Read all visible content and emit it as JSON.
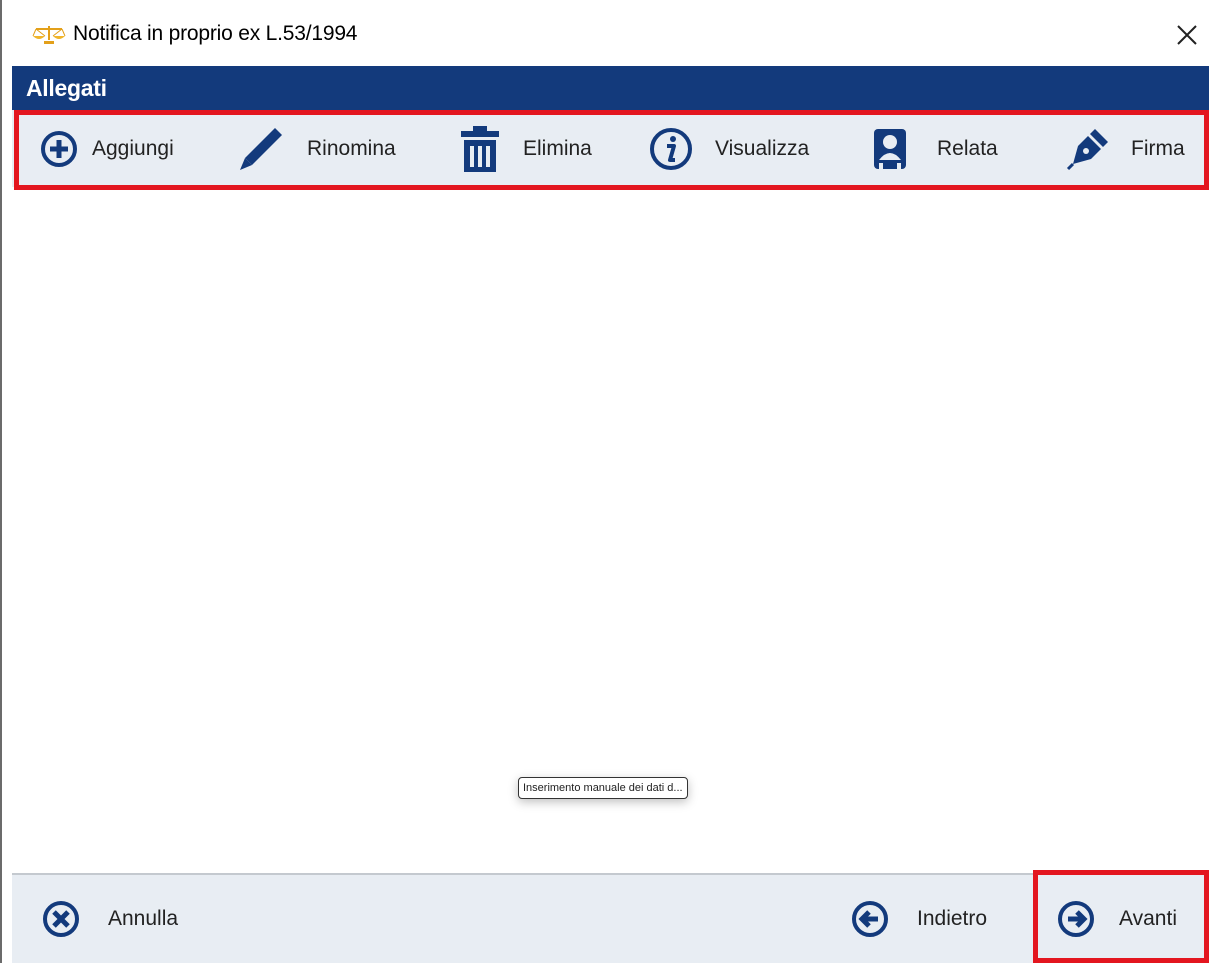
{
  "window": {
    "title": "Notifica in proprio ex L.53/1994",
    "close_icon": "close-icon"
  },
  "section": {
    "title": "Allegati"
  },
  "toolbar": {
    "items": [
      {
        "label": "Aggiungi",
        "icon": "add-circle-icon"
      },
      {
        "label": "Rinomina",
        "icon": "pencil-icon"
      },
      {
        "label": "Elimina",
        "icon": "trash-icon"
      },
      {
        "label": "Visualizza",
        "icon": "info-circle-icon"
      },
      {
        "label": "Relata",
        "icon": "person-badge-icon"
      },
      {
        "label": "Firma",
        "icon": "pen-nib-icon"
      }
    ]
  },
  "tooltip": {
    "text": "Inserimento manuale dei dati d..."
  },
  "footer": {
    "cancel_label": "Annulla",
    "back_label": "Indietro",
    "next_label": "Avanti"
  },
  "colors": {
    "header_bg": "#133a7c",
    "icon_blue": "#133a7c",
    "toolbar_bg": "#e8edf3",
    "highlight": "#e3161f",
    "app_icon": "#e3a01a"
  }
}
